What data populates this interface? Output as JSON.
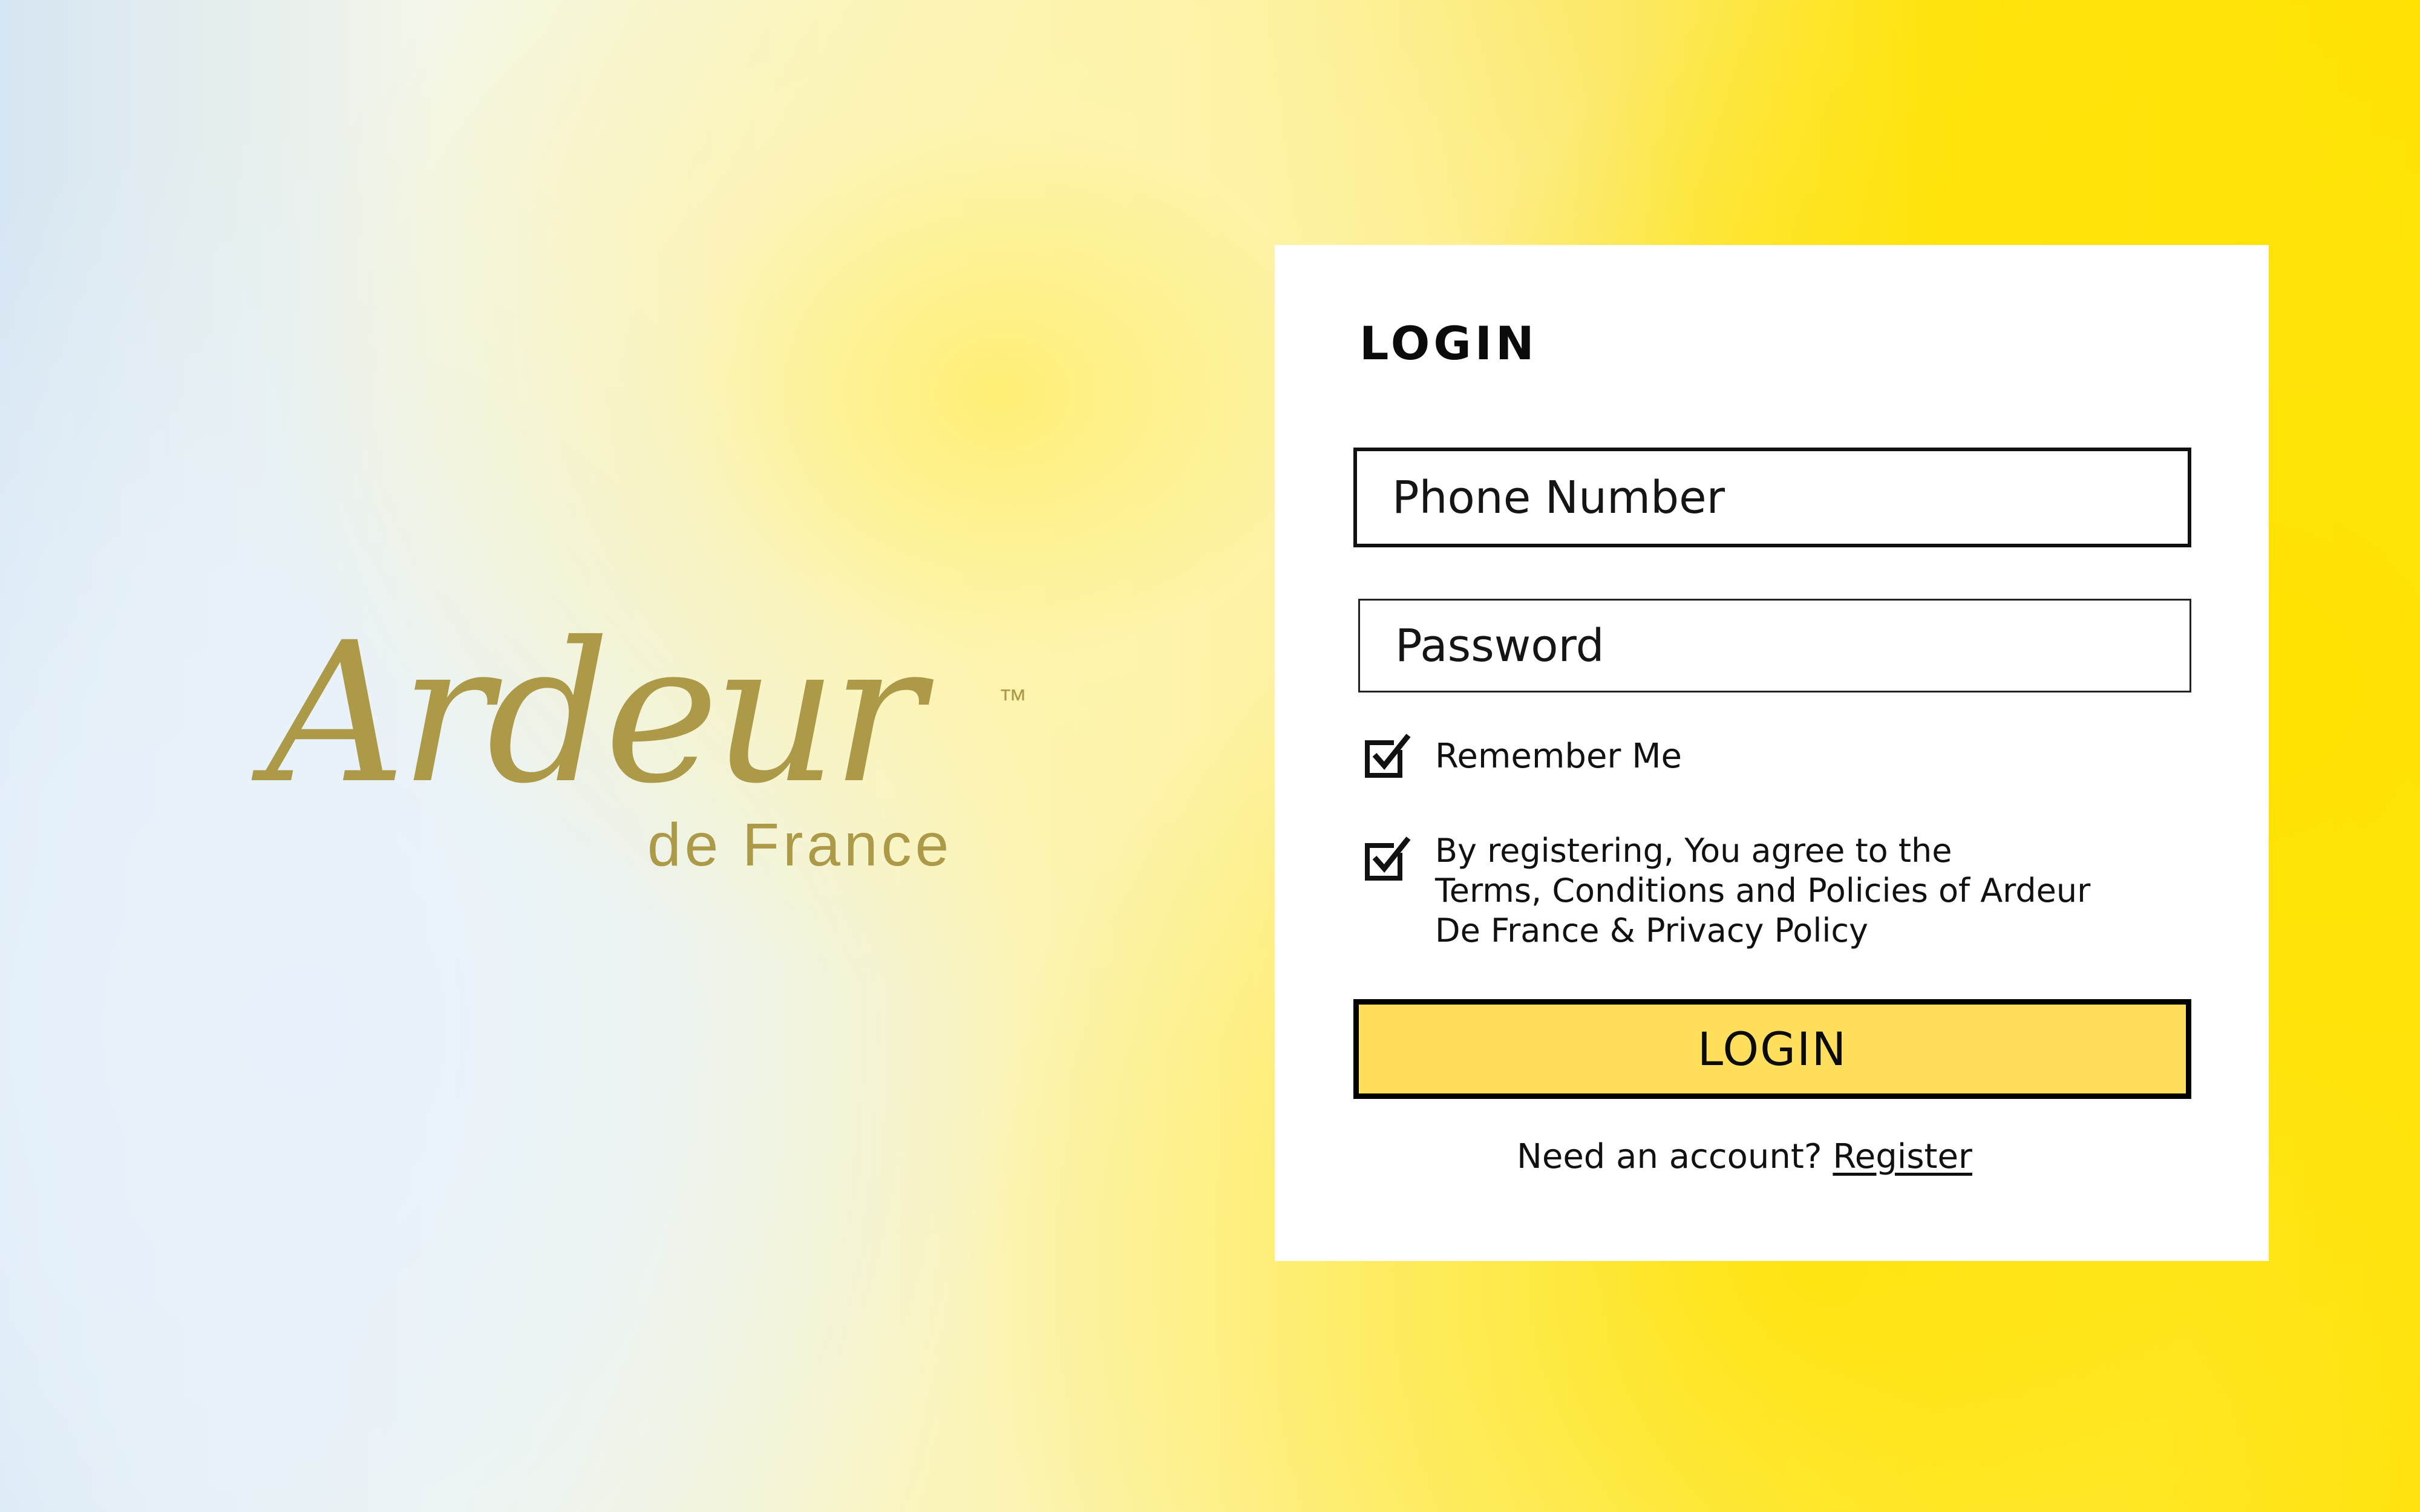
{
  "brand": {
    "logo_script": "Ardeur",
    "logo_trademark": "™",
    "logo_subtitle": "de France",
    "color": "#ad9a49"
  },
  "login_card": {
    "title": "LOGIN",
    "phone": {
      "placeholder": "Phone Number",
      "value": ""
    },
    "password": {
      "placeholder": "Password",
      "value": ""
    },
    "remember_me": {
      "label": "Remember Me",
      "checked": true
    },
    "terms": {
      "line1": "By registering, You agree to the",
      "line2": "Terms, Conditions and Policies of Ardeur",
      "line3": "De France & Privacy Policy",
      "checked": true
    },
    "login_button_label": "LOGIN",
    "account_prompt": "Need an account?",
    "register_link": "Register"
  },
  "colors": {
    "button_fill": "#ffdf5b",
    "border": "#000000",
    "background_accent": "#ffe000"
  }
}
